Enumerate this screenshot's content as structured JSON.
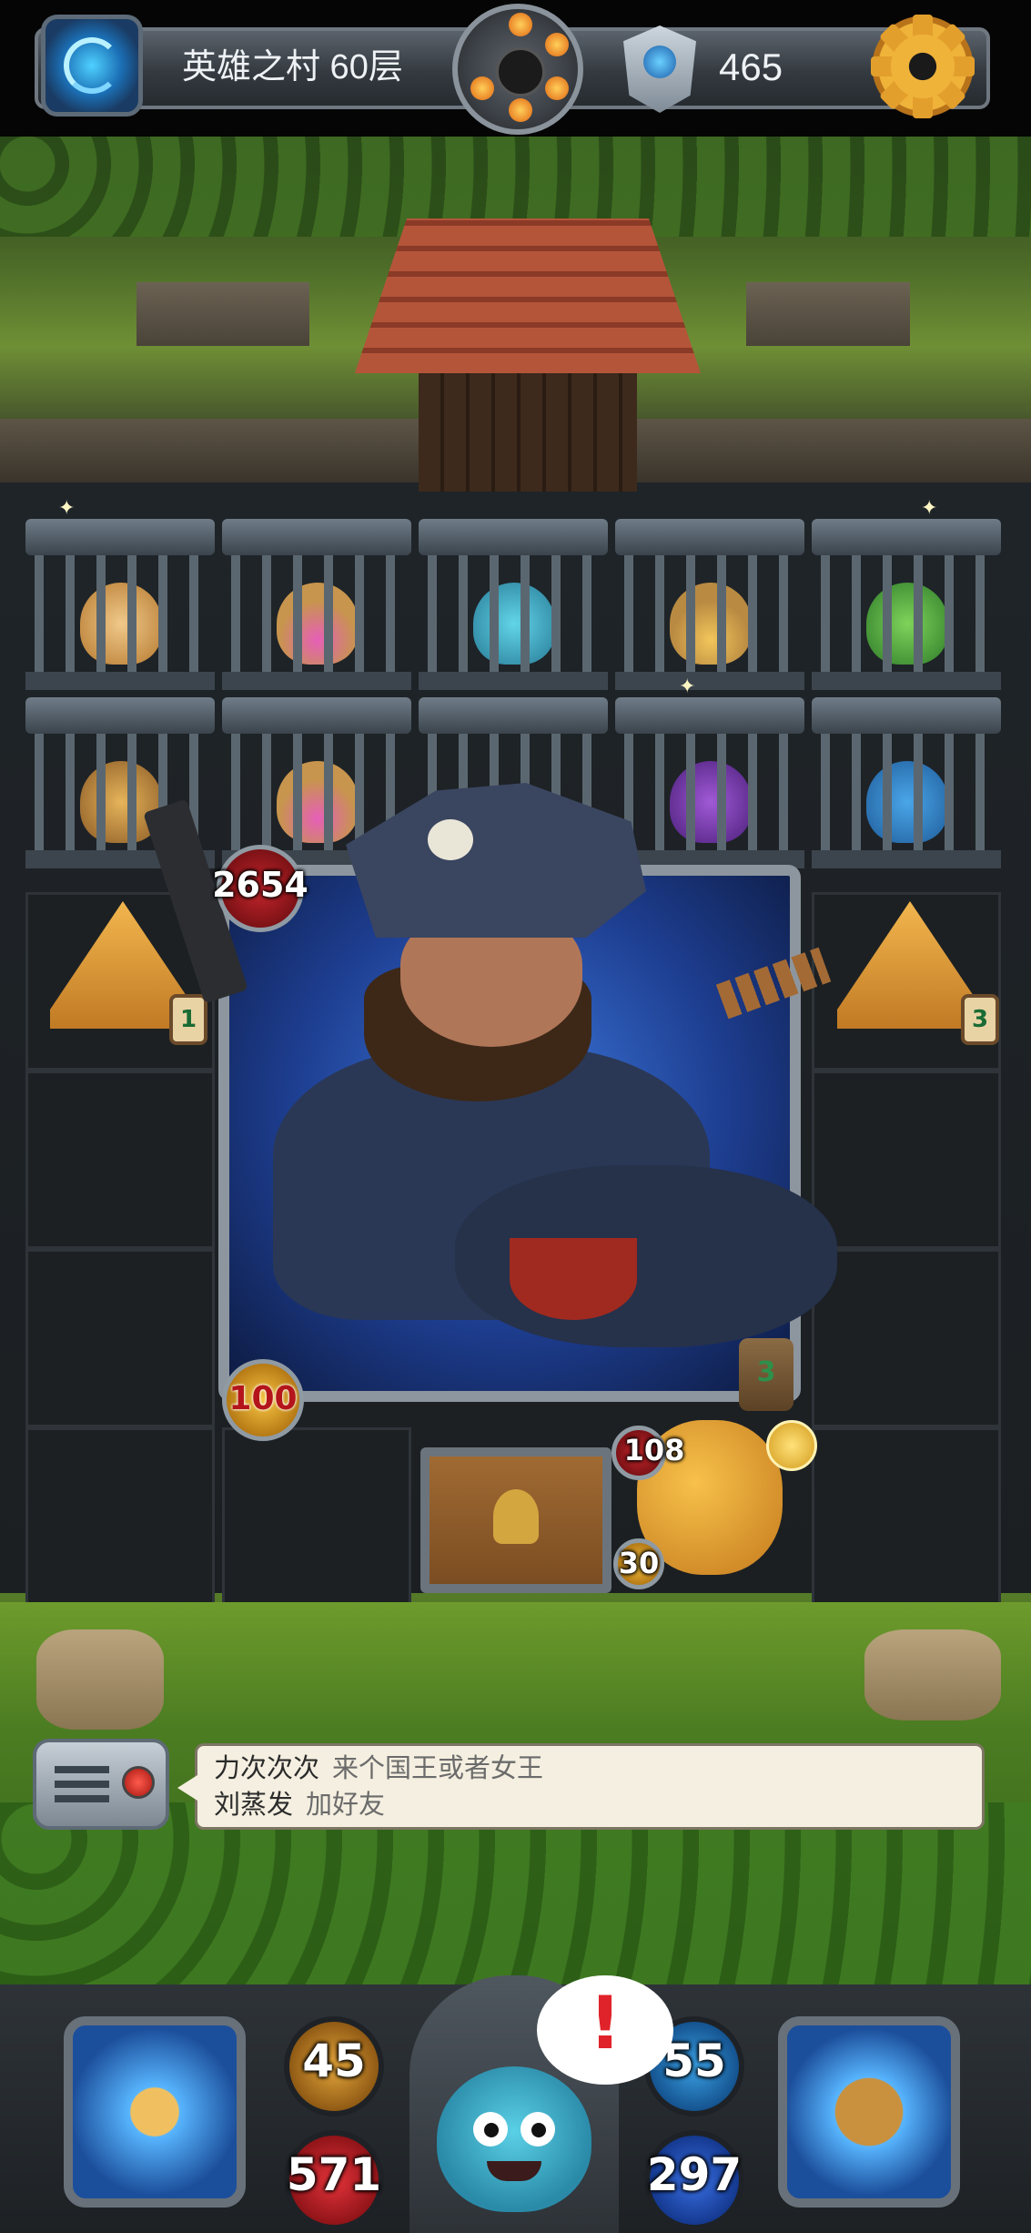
{
  "top_bar": {
    "floor_title": "英雄之村 60层",
    "gem_count": "465"
  },
  "board": {
    "boss": {
      "hp": "2654",
      "attack": "100"
    },
    "left_tent": {
      "count": "1"
    },
    "right_tent": {
      "count": "3"
    },
    "cat_monster": {
      "hp": "108",
      "attack": "30",
      "turns": "3"
    }
  },
  "chat": {
    "messages": [
      {
        "name": "力次次次",
        "text": "来个国王或者女王"
      },
      {
        "name": "刘蒸发",
        "text": "加好友"
      }
    ]
  },
  "player": {
    "attack": "45",
    "hp": "571",
    "defense": "55",
    "mana": "297",
    "alert_symbol": "!"
  }
}
